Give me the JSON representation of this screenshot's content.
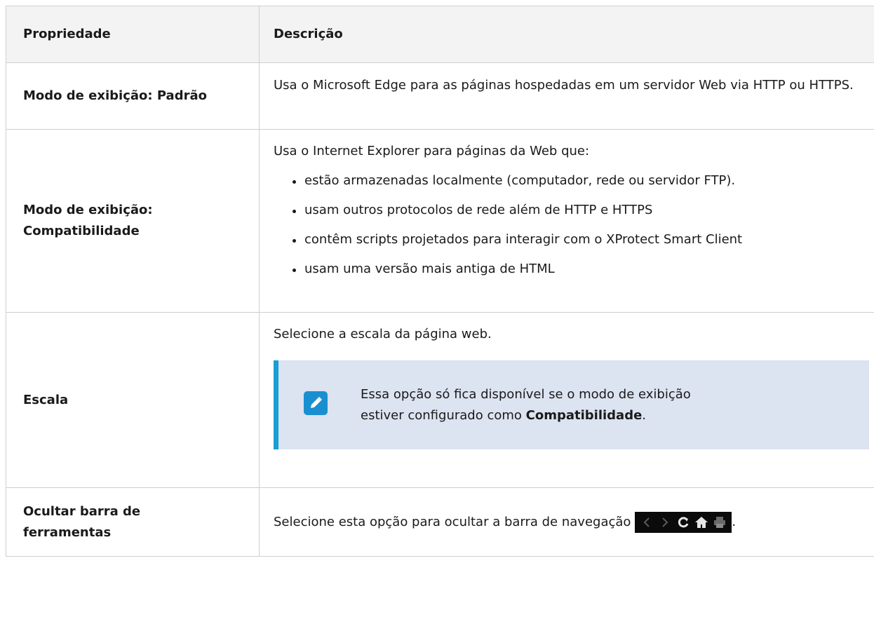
{
  "header": {
    "property": "Propriedade",
    "description": "Descrição"
  },
  "rows": [
    {
      "property": "Modo de exibição: Padrão",
      "description": "Usa o Microsoft Edge para as páginas hospedadas em um servidor Web via HTTP ou HTTPS."
    },
    {
      "property_line1": "Modo de exibição:",
      "property_line2": "Compatibilidade",
      "intro": "Usa o Internet Explorer para páginas da Web que:",
      "bullets": [
        "estão armazenadas localmente (computador, rede ou servidor FTP).",
        "usam outros protocolos de rede além de HTTP e HTTPS",
        "contêm scripts projetados para interagir com o XProtect Smart Client",
        "usam uma versão mais antiga de HTML"
      ]
    },
    {
      "property": "Escala",
      "description": "Selecione a escala da página web.",
      "note": {
        "line1": "Essa opção só fica disponível se o modo de exibição",
        "line2_prefix": "estiver configurado como ",
        "line2_bold": "Compatibilidade",
        "line2_suffix": ".",
        "icon": "pencil-note-icon"
      }
    },
    {
      "property_line1": "Ocultar barra de",
      "property_line2": "ferramentas",
      "description": "Selecione esta opção para ocultar a barra de navegação",
      "suffix": ".",
      "icons": [
        "back-arrow-icon",
        "forward-arrow-icon",
        "refresh-icon",
        "home-icon",
        "print-icon"
      ]
    }
  ],
  "colors": {
    "note_background": "#dce3f1",
    "note_accent": "#1a9ed6",
    "header_background": "#f3f3f3",
    "border": "#cfcfcf"
  }
}
